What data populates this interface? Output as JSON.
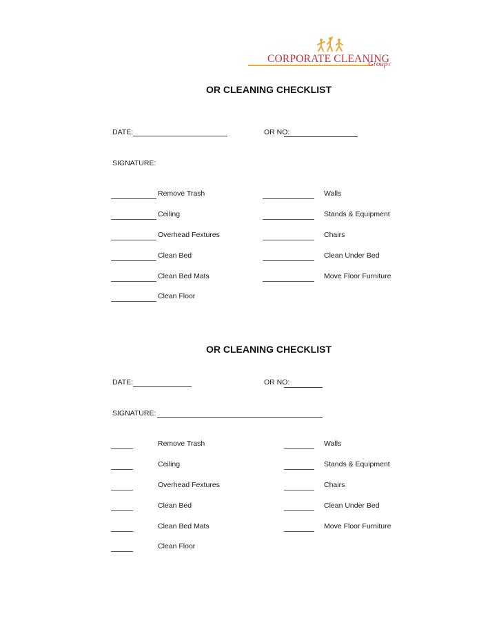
{
  "logo": {
    "main_text": "CORPORATE CLEANING",
    "sub_text": "Group",
    "trademark": "®",
    "icon": "cleaning-figures-icon",
    "colors": {
      "text": "#c2323a",
      "accent": "#e8a93a"
    }
  },
  "sections": [
    {
      "title": "OR CLEANING CHECKLIST",
      "date_label": "DATE:",
      "or_no_label": "OR NO:",
      "signature_label": "SIGNATURE:",
      "left_items": [
        "Remove Trash",
        "Ceiling",
        "Overhead Fextures",
        "Clean Bed",
        "Clean Bed Mats",
        "Clean Floor"
      ],
      "right_items": [
        "Walls",
        "Stands & Equipment",
        "Chairs",
        "Clean Under Bed",
        "Move Floor Furniture"
      ]
    },
    {
      "title": "OR CLEANING CHECKLIST",
      "date_label": "DATE:",
      "or_no_label": "OR NO:",
      "signature_label": "SIGNATURE:",
      "left_items": [
        "Remove Trash",
        "Ceiling",
        "Overhead Fextures",
        "Clean Bed",
        "Clean Bed Mats",
        "Clean Floor"
      ],
      "right_items": [
        "Walls",
        "Stands & Equipment",
        "Chairs",
        "Clean Under Bed",
        "Move Floor Furniture"
      ]
    }
  ]
}
